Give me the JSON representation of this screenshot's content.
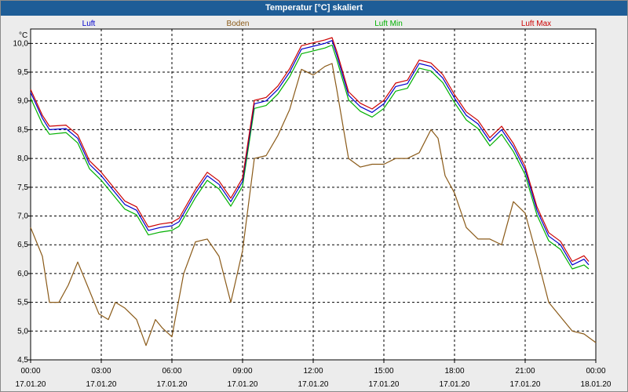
{
  "window": {
    "title": "Temperatur [°C] skaliert"
  },
  "chart_data": {
    "type": "line",
    "title": "Temperatur [°C] skaliert",
    "yunit": "°C",
    "ylim": [
      4.5,
      10.25
    ],
    "xlim": [
      0,
      24
    ],
    "grid": true,
    "legend_position": "top",
    "y_ticks": [
      "4,5",
      "5,0",
      "5,5",
      "6,0",
      "6,5",
      "7,0",
      "7,5",
      "8,0",
      "8,5",
      "9,0",
      "9,5",
      "10,0"
    ],
    "y_tick_values": [
      4.5,
      5.0,
      5.5,
      6.0,
      6.5,
      7.0,
      7.5,
      8.0,
      8.5,
      9.0,
      9.5,
      10.0
    ],
    "x_ticks": [
      {
        "time": "00:00",
        "date": "17.01.20",
        "h": 0
      },
      {
        "time": "03:00",
        "date": "17.01.20",
        "h": 3
      },
      {
        "time": "06:00",
        "date": "17.01.20",
        "h": 6
      },
      {
        "time": "09:00",
        "date": "17.01.20",
        "h": 9
      },
      {
        "time": "12:00",
        "date": "17.01.20",
        "h": 12
      },
      {
        "time": "15:00",
        "date": "17.01.20",
        "h": 15
      },
      {
        "time": "18:00",
        "date": "17.01.20",
        "h": 18
      },
      {
        "time": "21:00",
        "date": "17.01.20",
        "h": 21
      },
      {
        "time": "00:00",
        "date": "18.01.20",
        "h": 24
      }
    ],
    "series": [
      {
        "name": "Luft",
        "color": "#0000cc",
        "points": [
          [
            0,
            9.15
          ],
          [
            0.5,
            8.7
          ],
          [
            0.8,
            8.5
          ],
          [
            1.5,
            8.52
          ],
          [
            2,
            8.35
          ],
          [
            2.5,
            7.9
          ],
          [
            3,
            7.7
          ],
          [
            3.5,
            7.45
          ],
          [
            4,
            7.2
          ],
          [
            4.5,
            7.1
          ],
          [
            5,
            6.75
          ],
          [
            5.5,
            6.8
          ],
          [
            6,
            6.83
          ],
          [
            6.3,
            6.9
          ],
          [
            7,
            7.4
          ],
          [
            7.5,
            7.7
          ],
          [
            8,
            7.55
          ],
          [
            8.5,
            7.25
          ],
          [
            9,
            7.6
          ],
          [
            9.5,
            8.95
          ],
          [
            10,
            9.0
          ],
          [
            10.5,
            9.2
          ],
          [
            11,
            9.5
          ],
          [
            11.5,
            9.9
          ],
          [
            12,
            9.95
          ],
          [
            12.5,
            10.0
          ],
          [
            12.8,
            10.05
          ],
          [
            13,
            9.8
          ],
          [
            13.5,
            9.1
          ],
          [
            14,
            8.9
          ],
          [
            14.5,
            8.8
          ],
          [
            15,
            8.95
          ],
          [
            15.5,
            9.25
          ],
          [
            16,
            9.3
          ],
          [
            16.5,
            9.65
          ],
          [
            17,
            9.6
          ],
          [
            17.5,
            9.4
          ],
          [
            18,
            9.05
          ],
          [
            18.5,
            8.75
          ],
          [
            19,
            8.6
          ],
          [
            19.5,
            8.3
          ],
          [
            20,
            8.5
          ],
          [
            20.5,
            8.2
          ],
          [
            21,
            7.8
          ],
          [
            21.5,
            7.1
          ],
          [
            22,
            6.65
          ],
          [
            22.5,
            6.5
          ],
          [
            23,
            6.15
          ],
          [
            23.5,
            6.25
          ],
          [
            23.7,
            6.15
          ]
        ]
      },
      {
        "name": "Boden",
        "color": "#8a5a18",
        "points": [
          [
            0,
            6.8
          ],
          [
            0.5,
            6.3
          ],
          [
            0.8,
            5.5
          ],
          [
            1.2,
            5.5
          ],
          [
            1.6,
            5.8
          ],
          [
            2,
            6.2
          ],
          [
            2.5,
            5.7
          ],
          [
            2.9,
            5.3
          ],
          [
            3.3,
            5.2
          ],
          [
            3.6,
            5.5
          ],
          [
            4,
            5.4
          ],
          [
            4.5,
            5.2
          ],
          [
            4.9,
            4.75
          ],
          [
            5.3,
            5.2
          ],
          [
            5.6,
            5.05
          ],
          [
            6,
            4.9
          ],
          [
            6.5,
            6.0
          ],
          [
            7,
            6.55
          ],
          [
            7.5,
            6.6
          ],
          [
            8,
            6.3
          ],
          [
            8.5,
            5.5
          ],
          [
            9,
            6.4
          ],
          [
            9.5,
            8.0
          ],
          [
            10,
            8.05
          ],
          [
            10.5,
            8.4
          ],
          [
            11,
            8.85
          ],
          [
            11.5,
            9.55
          ],
          [
            12,
            9.45
          ],
          [
            12.5,
            9.6
          ],
          [
            12.8,
            9.65
          ],
          [
            13,
            9.2
          ],
          [
            13.5,
            8.0
          ],
          [
            14,
            7.85
          ],
          [
            14.5,
            7.9
          ],
          [
            15,
            7.9
          ],
          [
            15.5,
            8.0
          ],
          [
            16,
            8.0
          ],
          [
            16.5,
            8.1
          ],
          [
            17,
            8.5
          ],
          [
            17.3,
            8.35
          ],
          [
            17.6,
            7.7
          ],
          [
            18,
            7.4
          ],
          [
            18.5,
            6.8
          ],
          [
            19,
            6.6
          ],
          [
            19.5,
            6.6
          ],
          [
            20,
            6.5
          ],
          [
            20.5,
            7.25
          ],
          [
            21,
            7.05
          ],
          [
            21.5,
            6.3
          ],
          [
            22,
            5.5
          ],
          [
            22.5,
            5.25
          ],
          [
            23,
            5.0
          ],
          [
            23.5,
            4.95
          ],
          [
            24,
            4.8
          ]
        ]
      },
      {
        "name": "Luft Min",
        "color": "#00b000",
        "points": [
          [
            0,
            9.05
          ],
          [
            0.5,
            8.6
          ],
          [
            0.8,
            8.42
          ],
          [
            1.5,
            8.45
          ],
          [
            2,
            8.27
          ],
          [
            2.5,
            7.82
          ],
          [
            3,
            7.62
          ],
          [
            3.5,
            7.37
          ],
          [
            4,
            7.12
          ],
          [
            4.5,
            7.02
          ],
          [
            5,
            6.67
          ],
          [
            5.5,
            6.72
          ],
          [
            6,
            6.75
          ],
          [
            6.3,
            6.82
          ],
          [
            7,
            7.32
          ],
          [
            7.5,
            7.62
          ],
          [
            8,
            7.47
          ],
          [
            8.5,
            7.17
          ],
          [
            9,
            7.52
          ],
          [
            9.5,
            8.87
          ],
          [
            10,
            8.92
          ],
          [
            10.5,
            9.12
          ],
          [
            11,
            9.42
          ],
          [
            11.5,
            9.82
          ],
          [
            12,
            9.87
          ],
          [
            12.5,
            9.92
          ],
          [
            12.8,
            9.97
          ],
          [
            13,
            9.72
          ],
          [
            13.5,
            9.02
          ],
          [
            14,
            8.82
          ],
          [
            14.5,
            8.72
          ],
          [
            15,
            8.87
          ],
          [
            15.5,
            9.17
          ],
          [
            16,
            9.22
          ],
          [
            16.5,
            9.57
          ],
          [
            17,
            9.52
          ],
          [
            17.5,
            9.32
          ],
          [
            18,
            8.97
          ],
          [
            18.5,
            8.67
          ],
          [
            19,
            8.52
          ],
          [
            19.5,
            8.22
          ],
          [
            20,
            8.42
          ],
          [
            20.5,
            8.12
          ],
          [
            21,
            7.72
          ],
          [
            21.5,
            7.02
          ],
          [
            22,
            6.57
          ],
          [
            22.5,
            6.42
          ],
          [
            23,
            6.08
          ],
          [
            23.5,
            6.15
          ],
          [
            23.7,
            6.08
          ]
        ]
      },
      {
        "name": "Luft Max",
        "color": "#cc0000",
        "points": [
          [
            0,
            9.2
          ],
          [
            0.5,
            8.75
          ],
          [
            0.8,
            8.56
          ],
          [
            1.5,
            8.58
          ],
          [
            2,
            8.41
          ],
          [
            2.5,
            7.96
          ],
          [
            3,
            7.76
          ],
          [
            3.5,
            7.51
          ],
          [
            4,
            7.26
          ],
          [
            4.5,
            7.16
          ],
          [
            5,
            6.81
          ],
          [
            5.5,
            6.86
          ],
          [
            6,
            6.89
          ],
          [
            6.3,
            6.96
          ],
          [
            7,
            7.46
          ],
          [
            7.5,
            7.76
          ],
          [
            8,
            7.61
          ],
          [
            8.5,
            7.31
          ],
          [
            9,
            7.66
          ],
          [
            9.5,
            9.01
          ],
          [
            10,
            9.06
          ],
          [
            10.5,
            9.26
          ],
          [
            11,
            9.56
          ],
          [
            11.5,
            9.96
          ],
          [
            12,
            10.01
          ],
          [
            12.5,
            10.06
          ],
          [
            12.8,
            10.1
          ],
          [
            13,
            9.86
          ],
          [
            13.5,
            9.16
          ],
          [
            14,
            8.96
          ],
          [
            14.5,
            8.86
          ],
          [
            15,
            9.01
          ],
          [
            15.5,
            9.31
          ],
          [
            16,
            9.36
          ],
          [
            16.5,
            9.71
          ],
          [
            17,
            9.66
          ],
          [
            17.5,
            9.46
          ],
          [
            18,
            9.11
          ],
          [
            18.5,
            8.81
          ],
          [
            19,
            8.66
          ],
          [
            19.5,
            8.36
          ],
          [
            20,
            8.56
          ],
          [
            20.5,
            8.26
          ],
          [
            21,
            7.86
          ],
          [
            21.5,
            7.16
          ],
          [
            22,
            6.71
          ],
          [
            22.5,
            6.56
          ],
          [
            23,
            6.21
          ],
          [
            23.5,
            6.31
          ],
          [
            23.7,
            6.21
          ]
        ]
      }
    ]
  }
}
